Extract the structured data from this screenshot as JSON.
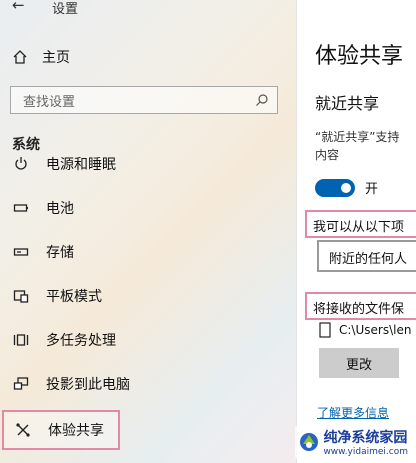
{
  "window": {
    "title": "设置"
  },
  "sidebar": {
    "home_label": "主页",
    "search_placeholder": "查找设置",
    "section_label": "系统",
    "items": [
      {
        "label": "电源和睡眠",
        "icon": "power-icon"
      },
      {
        "label": "电池",
        "icon": "battery-icon"
      },
      {
        "label": "存储",
        "icon": "storage-icon"
      },
      {
        "label": "平板模式",
        "icon": "tablet-mode-icon"
      },
      {
        "label": "多任务处理",
        "icon": "multitasking-icon"
      },
      {
        "label": "投影到此电脑",
        "icon": "projecting-icon"
      },
      {
        "label": "体验共享",
        "icon": "shared-experiences-icon",
        "active": true
      }
    ]
  },
  "main": {
    "title": "体验共享",
    "nearby_heading": "就近共享",
    "nearby_desc_line1": "“就近共享”支持",
    "nearby_desc_line2": "内容",
    "toggle_label": "开",
    "share_from_label": "我可以从以下项",
    "share_from_value": "附近的任何人",
    "save_location_label": "将接收的文件保",
    "save_path": "C:\\Users\\len",
    "change_button": "更改",
    "learn_more": "了解更多信息"
  },
  "watermark": {
    "text": "纯净系统家园",
    "url": "www.yidaimei.com"
  },
  "colors": {
    "accent": "#0063b1",
    "highlight": "#e18aa8"
  }
}
